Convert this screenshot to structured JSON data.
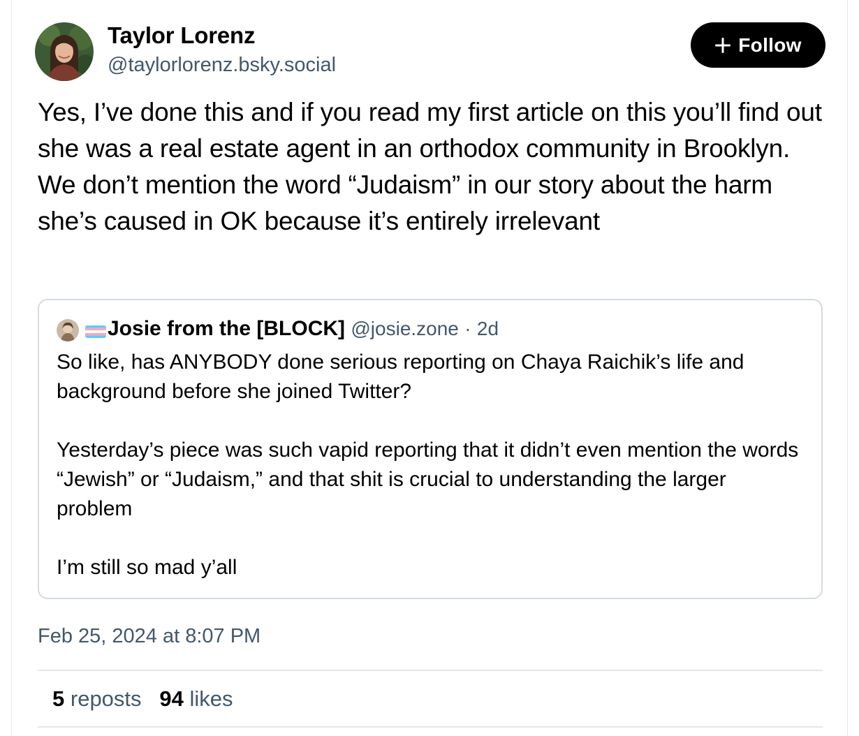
{
  "author": {
    "name": "Taylor Lorenz",
    "handle": "@taylorlorenz.bsky.social"
  },
  "follow_button": {
    "label": "Follow",
    "icon": "plus-icon"
  },
  "post": {
    "text": "Yes, I’ve done this and if you read my first article on this you’ll find out she was a real estate agent in an orthodox community in Brooklyn. We don’t mention the word “Judaism” in our story about the harm she’s caused in OK because it’s entirely irrelevant",
    "timestamp": "Feb 25, 2024 at 8:07 PM"
  },
  "quote": {
    "author_name": "Josie from the [BLOCK]",
    "author_flag": "transgender-flag-icon",
    "handle": "@josie.zone",
    "separator": "·",
    "age": "2d",
    "paragraphs": [
      "So like, has ANYBODY done serious reporting on Chaya Raichik’s life and background before she joined Twitter?",
      "Yesterday’s piece was such vapid reporting that it didn’t even mention the words “Jewish” or “Judaism,” and that shit is crucial to understanding the larger problem",
      "I’m still so mad y’all"
    ]
  },
  "stats": {
    "reposts_count": "5",
    "reposts_label": "reposts",
    "likes_count": "94",
    "likes_label": "likes"
  },
  "colors": {
    "text": "#000000",
    "muted": "#42576c",
    "border": "#d4dbe2",
    "divider": "#e3e7ec",
    "button_bg": "#000000",
    "button_text": "#ffffff"
  }
}
